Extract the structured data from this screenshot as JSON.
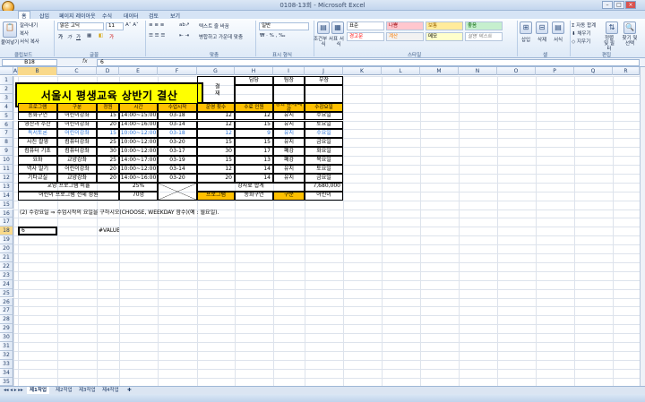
{
  "window": {
    "title": "0108-13회 - Microsoft Excel"
  },
  "ribbon_tabs": [
    "홈",
    "삽입",
    "페이지 레이아웃",
    "수식",
    "데이터",
    "검토",
    "보기"
  ],
  "ribbon": {
    "paste": "붙여넣기",
    "cut": "잘라내기",
    "copy": "복사",
    "format_painter": "서식 복사",
    "clipboard": "클립보드",
    "font_name": "맑은 고딕",
    "font_size": "11",
    "font_group": "글꼴",
    "wrap_text": "텍스트 줄 바꿈",
    "merge_center": "병합하고 가운데 맞춤",
    "align_group": "맞춤",
    "number_format": "일반",
    "number_group": "표시 형식",
    "cond_format": "조건부 서식",
    "table_format": "표 서식",
    "styles_group": "스타일",
    "styles": [
      {
        "label": "표준",
        "bg": "#ffffff",
        "fg": "#000000"
      },
      {
        "label": "나쁨",
        "bg": "#ffc7ce",
        "fg": "#9c0006"
      },
      {
        "label": "보통",
        "bg": "#ffeb9c",
        "fg": "#9c6500"
      },
      {
        "label": "좋음",
        "bg": "#c6efce",
        "fg": "#006100"
      },
      {
        "label": "경고문",
        "bg": "#ffffff",
        "fg": "#ff0000"
      },
      {
        "label": "계산",
        "bg": "#f2f2f2",
        "fg": "#fa7d00"
      },
      {
        "label": "메모",
        "bg": "#ffffcc",
        "fg": "#000000"
      },
      {
        "label": "설명 텍스트",
        "bg": "#ffffff",
        "fg": "#7f7f7f"
      }
    ],
    "insert": "삽입",
    "delete": "삭제",
    "format": "서식",
    "cells_group": "셀",
    "autosum": "자동 합계",
    "fill": "채우기",
    "clear": "지우기",
    "sort": "정렬 및 필터",
    "find": "찾기 및 선택",
    "edit_group": "편집"
  },
  "formula": {
    "name_box": "B18",
    "fx": "fx",
    "value": "6"
  },
  "columns": [
    "A",
    "B",
    "C",
    "D",
    "E",
    "F",
    "G",
    "H",
    "I",
    "J",
    "K",
    "L",
    "M",
    "N",
    "O",
    "P",
    "Q",
    "R"
  ],
  "rows": [
    "1",
    "2",
    "3",
    "4",
    "5",
    "6",
    "7",
    "8",
    "9",
    "10",
    "11",
    "12",
    "13",
    "14",
    "15",
    "16",
    "17",
    "18",
    "19",
    "20",
    "21",
    "22",
    "23",
    "24",
    "25",
    "26",
    "27",
    "28",
    "29",
    "30",
    "31",
    "32",
    "33",
    "34",
    "35"
  ],
  "sheet": {
    "title": "서울시 평생교육 상반기 결산",
    "approval": {
      "label": "결 재",
      "cols": [
        "담당",
        "팀장",
        "부장"
      ]
    },
    "headers": [
      "프로그램",
      "구분",
      "정원",
      "시간",
      "수업시작",
      "운영 횟수",
      "수료 인원",
      "강좌 유지/폐강",
      "수강요일"
    ],
    "rows": [
      {
        "c": [
          "동화구연",
          "어린이강좌",
          "15",
          "14:00~15:00",
          "03-18",
          "12",
          "12",
          "유지",
          "수요일"
        ],
        "blue": false
      },
      {
        "c": [
          "영산과 주산",
          "어린이강좌",
          "20",
          "14:00~16:00",
          "03-14",
          "12",
          "15",
          "유지",
          "토요일"
        ],
        "blue": false
      },
      {
        "c": [
          "독서토론",
          "어린이강좌",
          "15",
          "10:00~12:00",
          "03-18",
          "12",
          "9",
          "유지",
          "수요일"
        ],
        "blue": true
      },
      {
        "c": [
          "사진 촬영",
          "컴퓨터강좌",
          "25",
          "10:00~12:00",
          "03-20",
          "15",
          "15",
          "유지",
          "금요일"
        ],
        "blue": false
      },
      {
        "c": [
          "컴퓨터 기초",
          "컴퓨터강좌",
          "30",
          "10:00~12:00",
          "03-17",
          "30",
          "17",
          "폐강",
          "화요일"
        ],
        "blue": false
      },
      {
        "c": [
          "요화",
          "교양강좌",
          "25",
          "14:00~17:00",
          "03-19",
          "15",
          "13",
          "폐강",
          "목요일"
        ],
        "blue": false
      },
      {
        "c": [
          "역사 알기",
          "어린이강좌",
          "20",
          "10:00~12:00",
          "03-14",
          "12",
          "14",
          "유지",
          "토요일"
        ],
        "blue": false
      },
      {
        "c": [
          "기타교실",
          "교양강좌",
          "20",
          "14:00~16:00",
          "03-20",
          "20",
          "14",
          "유지",
          "금요일"
        ],
        "blue": false
      }
    ],
    "r13": {
      "label": "교양 프로그램 비율",
      "value": "25%",
      "total_label": "강사료 합계",
      "total_value": "7,680,000"
    },
    "r14": {
      "label": "어린이 프로그램 전체 정원",
      "value": "70명",
      "k1": "프로그램",
      "v1": "동화구연",
      "k2": "구분",
      "v2": "어린이"
    },
    "r16": "(2) 수강요일 ⇒ 수업시작의 요일을 구하시오(CHOOSE, WEEKDAY 함수)(예 : 월요일).",
    "b18": "6",
    "d18": "#VALUE!"
  },
  "sheet_tabs": [
    "제1작업",
    "제2작업",
    "제3작업",
    "제4작업"
  ],
  "accent": "#ffc000"
}
